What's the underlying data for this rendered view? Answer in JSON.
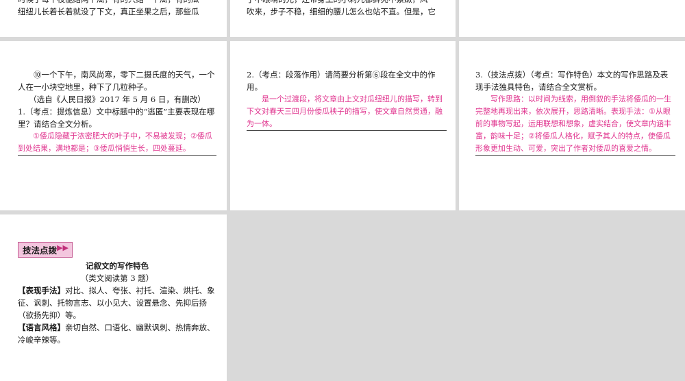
{
  "top_strip": {
    "left_line1": "时候于每个枝能结两个瓜，有的只结一个瓜，有的瓜",
    "left_line2": "纽纽儿长着长着就没了下文，真正坐果之后，那些瓜",
    "mid_line1": "了不眼晴的光，还带身上的小刺儿都鲜亮不紫嫩，风",
    "mid_line2": "吹来，步子不稳，细细的腰儿怎么也站不直。但是，它"
  },
  "panel1": {
    "para10": "⑩一个下午，南风尚寒，零下二摄氏度的天气，一个人在一小块空地里，种下了几粒种子。",
    "source": "（选自《人民日报》2017 年 5 月 6 日，有删改）",
    "q1": "1.（考点：提炼信息）文中标题中的“逃匿”主要表现在哪里？请结合全文分析。",
    "a1": "①倭瓜隐藏于浓密肥大的叶子中，不易被发现；②倭瓜到处结果，满地都是；③倭瓜悄悄生长，四处蔓延。"
  },
  "panel2": {
    "q2": "2.（考点：段落作用）请简要分析第⑥段在全文中的作用。",
    "a2": "是一个过渡段，将文章由上文对瓜纽纽儿的描写，转到下文对春天三四月份倭瓜秧子的描写，使文章自然贯通，融为一体。"
  },
  "panel3": {
    "q3": "3.（技法点拨）（考点：写作特色）本文的写作思路及表现手法独具特色，请结合全文赏析。",
    "a3": "写作思路：以时间为线索，用倒叙的手法将倭瓜的一生完整地再现出来，依次展开，思路清晰。表现手法：①从眼前的事物写起，运用联想和想象，虚实结合，使文章内涵丰富，韵味十足；②将倭瓜人格化，赋予其人的特点，使倭瓜形象更加生动、可爱，突出了作者对倭瓜的喜爱之情。"
  },
  "panel4": {
    "tag": "技法点拨",
    "tag_arrow": "▶▶",
    "title": "记叙文的写作特色",
    "subtitle": "（类文阅读第 3 题）",
    "label1": "【表现手法】",
    "text1": "对比、拟人、夸张、衬托、渲染、烘托、象征、讽刺、托物言志、以小见大、设置悬念、先抑后扬（欲扬先抑）等。",
    "label2": "【语言风格】",
    "text2": "亲切自然、口语化、幽默讽刺、热情奔放、冷峻辛辣等。"
  }
}
